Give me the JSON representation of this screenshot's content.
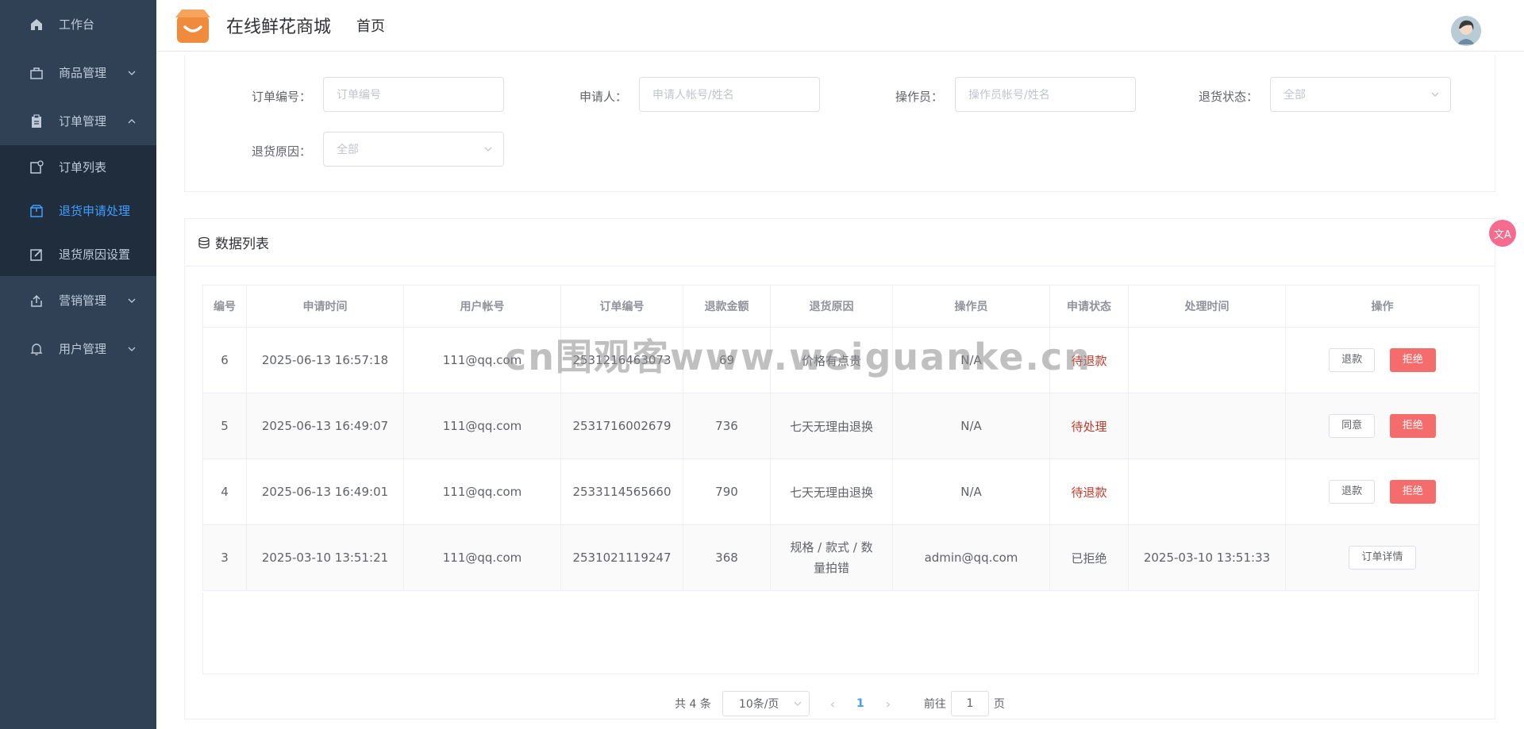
{
  "app": {
    "title": "在线鲜花商城",
    "breadcrumb": "首页"
  },
  "sidebar": {
    "items": [
      {
        "label": "工作台",
        "icon": "home-icon"
      },
      {
        "label": "商品管理",
        "icon": "bag-icon"
      },
      {
        "label": "订单管理",
        "icon": "clipboard-icon"
      },
      {
        "label": "营销管理",
        "icon": "upload-icon"
      },
      {
        "label": "用户管理",
        "icon": "bell-icon"
      }
    ],
    "order_sub": [
      {
        "label": "订单列表",
        "icon": "list-icon"
      },
      {
        "label": "退货申请处理",
        "icon": "box-icon"
      },
      {
        "label": "退货原因设置",
        "icon": "edit-icon"
      }
    ]
  },
  "filter": {
    "order_no": {
      "label": "订单编号：",
      "placeholder": "订单编号"
    },
    "applicant": {
      "label": "申请人：",
      "placeholder": "申请人帐号/姓名"
    },
    "operator": {
      "label": "操作员：",
      "placeholder": "操作员帐号/姓名"
    },
    "status": {
      "label": "退货状态：",
      "value": "全部"
    },
    "reason": {
      "label": "退货原因：",
      "value": "全部"
    }
  },
  "list": {
    "title": "数据列表",
    "columns": [
      "编号",
      "申请时间",
      "用户帐号",
      "订单编号",
      "退款金额",
      "退货原因",
      "操作员",
      "申请状态",
      "处理时间",
      "操作"
    ],
    "rows": [
      {
        "id": "6",
        "time": "2025-06-13 16:57:18",
        "user": "111@qq.com",
        "order": "2531216463073",
        "amount": "69",
        "reason": "价格有点贵",
        "operator": "N/A",
        "status": "待退款",
        "handled": "",
        "actions": [
          "退款",
          "拒绝"
        ]
      },
      {
        "id": "5",
        "time": "2025-06-13 16:49:07",
        "user": "111@qq.com",
        "order": "2531716002679",
        "amount": "736",
        "reason": "七天无理由退换",
        "operator": "N/A",
        "status": "待处理",
        "handled": "",
        "actions": [
          "同意",
          "拒绝"
        ]
      },
      {
        "id": "4",
        "time": "2025-06-13 16:49:01",
        "user": "111@qq.com",
        "order": "2533114565660",
        "amount": "790",
        "reason": "七天无理由退换",
        "operator": "N/A",
        "status": "待退款",
        "handled": "",
        "actions": [
          "退款",
          "拒绝"
        ]
      },
      {
        "id": "3",
        "time": "2025-03-10 13:51:21",
        "user": "111@qq.com",
        "order": "2531021119247",
        "amount": "368",
        "reason": "规格 / 款式 / 数量拍错",
        "operator": "admin@qq.com",
        "status": "已拒绝",
        "handled": "2025-03-10 13:51:33",
        "actions": [
          "订单详情"
        ]
      }
    ]
  },
  "pager": {
    "total": "共 4 条",
    "size": "10条/页",
    "page": "1",
    "goto": "前往",
    "goto_value": "1",
    "unit": "页"
  },
  "watermark": "cn围观客www.weiguanke.cn",
  "translate": "文A"
}
